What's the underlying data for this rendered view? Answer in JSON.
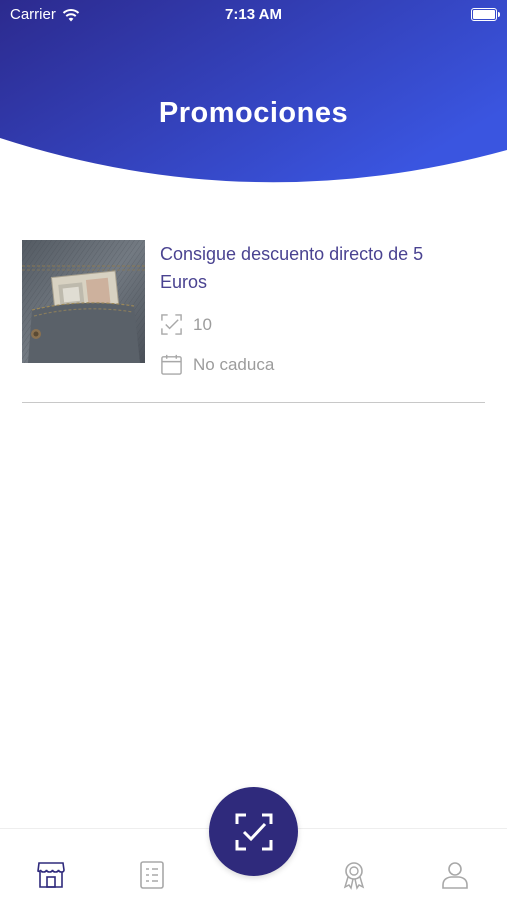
{
  "status_bar": {
    "carrier": "Carrier",
    "time": "7:13 AM"
  },
  "header": {
    "title": "Promociones",
    "gradient_start": "#2c2a8e",
    "gradient_end": "#3a55e0"
  },
  "promotions": [
    {
      "title": "Consigue descuento directo de 5 Euros",
      "uses": "10",
      "expiry": "No caduca",
      "image": "jeans-pocket-banknote"
    }
  ],
  "tabbar": {
    "items": [
      {
        "name": "store-icon",
        "active": true
      },
      {
        "name": "list-icon",
        "active": false
      },
      {
        "name": "scan-check-icon",
        "active": false
      },
      {
        "name": "award-icon",
        "active": false
      },
      {
        "name": "user-icon",
        "active": false
      }
    ],
    "active_color": "#2f2a7c",
    "inactive_color": "#a8a8a8"
  }
}
